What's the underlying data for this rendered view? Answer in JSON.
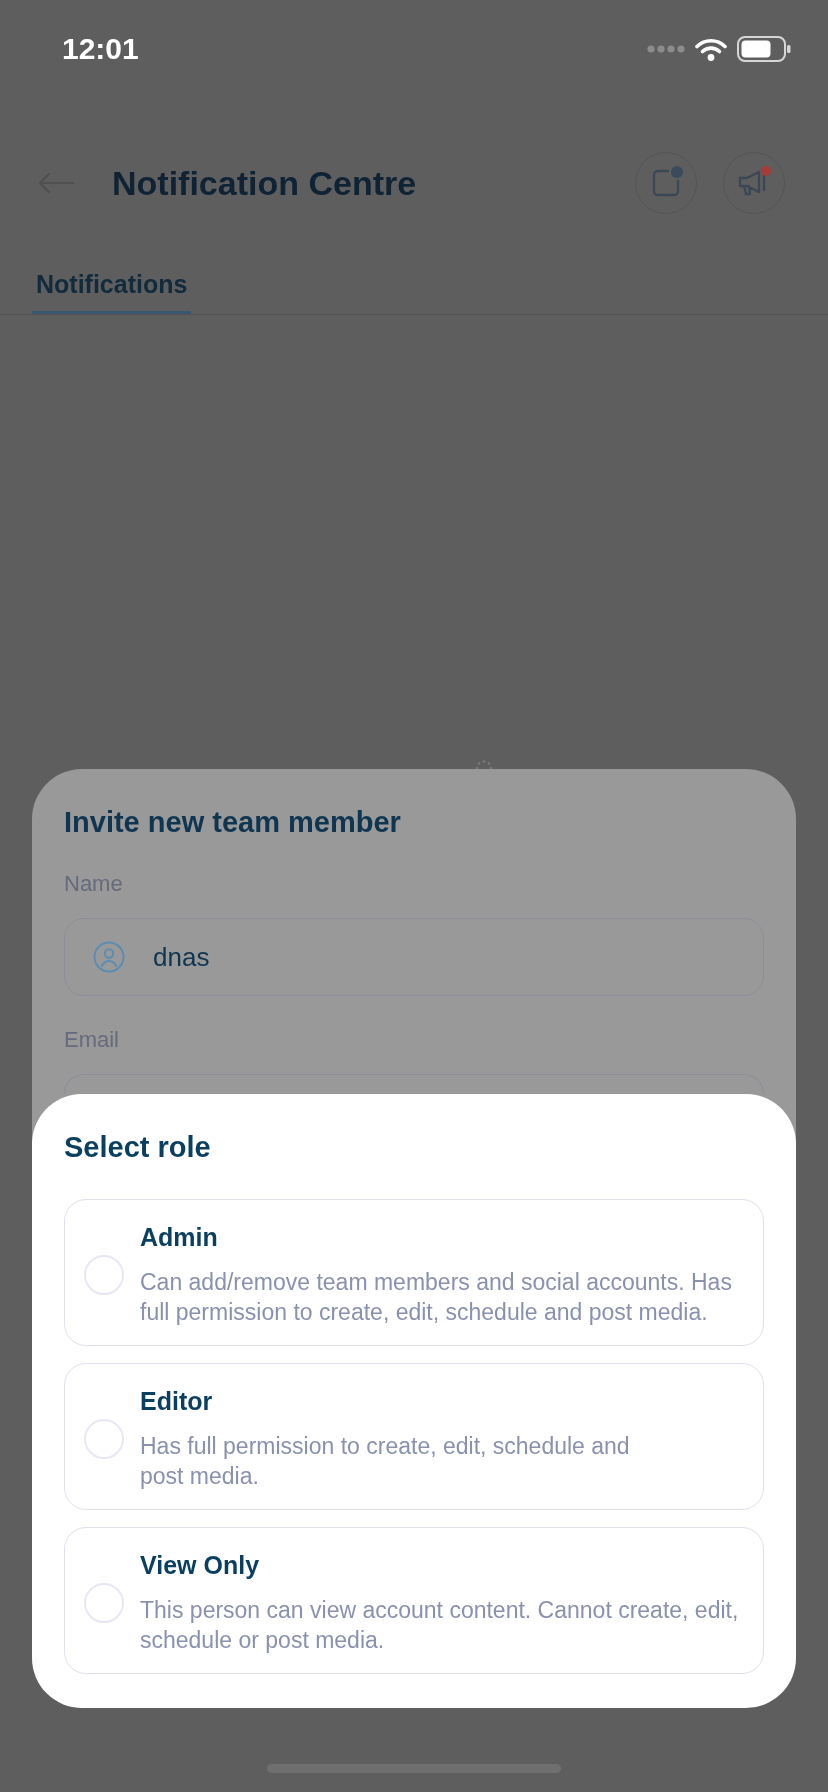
{
  "status_bar": {
    "time": "12:01"
  },
  "header": {
    "title": "Notification Centre",
    "actions": [
      {
        "kind": "note",
        "color": "#3b4a5d"
      },
      {
        "kind": "megaphone",
        "color": "#a83a3a"
      }
    ]
  },
  "tabs": [
    {
      "label": "Notifications",
      "selected": true
    }
  ],
  "invite_sheet": {
    "title": "Invite new team member",
    "fields": [
      {
        "label": "Name",
        "kind": "name",
        "value": "dnas"
      },
      {
        "label": "Email",
        "kind": "email"
      }
    ]
  },
  "role_sheet": {
    "title": "Select role",
    "options": [
      {
        "title": "Admin",
        "description": "Can add/remove team members and social accounts. Has full permission to create, edit, schedule and post media.",
        "selected": false
      },
      {
        "title": "Editor",
        "description": "Has full permission to create, edit, schedule and\npost media.",
        "selected": false
      },
      {
        "title": "View Only",
        "description": "This person can view account content. Cannot create, edit, schedule or post media.",
        "selected": false
      }
    ]
  }
}
